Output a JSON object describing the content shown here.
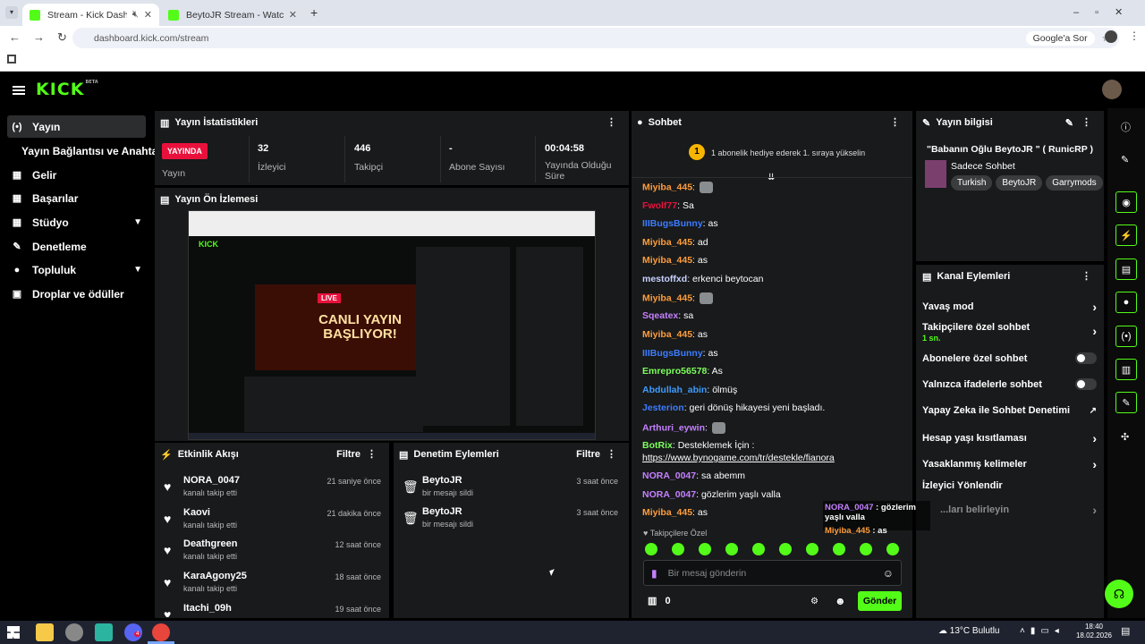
{
  "browser": {
    "tabs": [
      {
        "title": "Stream - Kick Dashboard"
      },
      {
        "title": "BeytoJR Stream - Watch Live on"
      }
    ],
    "url": "dashboard.kick.com/stream",
    "google_btn": "Google'a Sor"
  },
  "app": {
    "logo": "KICK",
    "beta": "BETA"
  },
  "sidebar": {
    "items": [
      {
        "label": "Yayın",
        "icon": "broadcast-icon"
      },
      {
        "label": "Yayın Bağlantısı ve Anahtarı"
      },
      {
        "label": "Gelir",
        "icon": "chart-icon"
      },
      {
        "label": "Başarılar",
        "icon": "trophy-icon"
      },
      {
        "label": "Stüdyo",
        "icon": "grid-icon"
      },
      {
        "label": "Denetleme",
        "icon": "wrench-icon"
      },
      {
        "label": "Topluluk",
        "icon": "people-icon"
      },
      {
        "label": "Droplar ve ödüller",
        "icon": "gift-icon"
      }
    ]
  },
  "stats": {
    "title": "Yayın İstatistikleri",
    "live_badge": "YAYINDA",
    "live_label": "Yayın",
    "viewers": "32",
    "viewers_label": "İzleyici",
    "followers": "446",
    "followers_label": "Takipçi",
    "subs": "-",
    "subs_label": "Abone Sayısı",
    "uptime": "00:04:58",
    "uptime_label": "Yayında Olduğu Süre"
  },
  "preview": {
    "title": "Yayın Ön İzlemesi",
    "thumb_text": "CANLI YAYIN BAŞLIYOR!",
    "thumb_live": "LIVE"
  },
  "activity": {
    "title": "Etkinlik Akışı",
    "filter": "Filtre",
    "items": [
      {
        "name": "NORA_0047",
        "sub": "kanalı takip etti",
        "time": "21 saniye önce"
      },
      {
        "name": "Kaovi",
        "sub": "kanalı takip etti",
        "time": "21 dakika önce"
      },
      {
        "name": "Deathgreen",
        "sub": "kanalı takip etti",
        "time": "12 saat önce"
      },
      {
        "name": "KaraAgony25",
        "sub": "kanalı takip etti",
        "time": "18 saat önce"
      },
      {
        "name": "Itachi_09h",
        "sub": "",
        "time": "19 saat önce"
      }
    ]
  },
  "moderation": {
    "title": "Denetim Eylemleri",
    "filter": "Filtre",
    "items": [
      {
        "name": "BeytoJR",
        "sub": "bir mesajı sildi",
        "time": "3 saat önce"
      },
      {
        "name": "BeytoJR",
        "sub": "bir mesajı sildi",
        "time": "3 saat önce"
      }
    ]
  },
  "chat": {
    "title": "Sohbet",
    "banner": "1 abonelik hediye ederek 1. sıraya yükselin",
    "banner_num": "1",
    "messages": [
      {
        "user": "Miyiba_445",
        "color": "#ff9d3c",
        "text": ""
      },
      {
        "user": "Fwolf77",
        "color": "#e9113c",
        "text": "Sa"
      },
      {
        "user": "IIIBugsBunny",
        "color": "#3d7cff",
        "text": "as"
      },
      {
        "user": "Miyiba_445",
        "color": "#ff9d3c",
        "text": "ad"
      },
      {
        "user": "Miyiba_445",
        "color": "#ff9d3c",
        "text": "as"
      },
      {
        "user": "mestoffxd",
        "color": "#c9d1ff",
        "text": "erkenci beytocan"
      },
      {
        "user": "Miyiba_445",
        "color": "#ff9d3c",
        "text": ""
      },
      {
        "user": "Sqeatex",
        "color": "#c580ff",
        "text": "sa"
      },
      {
        "user": "Miyiba_445",
        "color": "#ff9d3c",
        "text": "as"
      },
      {
        "user": "IIIBugsBunny",
        "color": "#3d7cff",
        "text": "as"
      },
      {
        "user": "Emrepro56578",
        "color": "#7dff5c",
        "text": "As"
      },
      {
        "user": "Abdullah_abin",
        "color": "#3d9cff",
        "text": "ölmüş"
      },
      {
        "user": "Jesterion",
        "color": "#3d7cff",
        "text": "geri dönüş hikayesi yeni başladı."
      },
      {
        "user": "Arthuri_eywin",
        "color": "#c580ff",
        "text": ""
      },
      {
        "user": "BotRix",
        "color": "#7dff5c",
        "text": "Desteklemek İçin :"
      },
      {
        "user": "",
        "color": "#fff",
        "text": "https://www.bynogame.com/tr/destekle/fianora"
      },
      {
        "user": "NORA_0047",
        "color": "#c580ff",
        "text": "sa abemm"
      },
      {
        "user": "NORA_0047",
        "color": "#c580ff",
        "text": "gözlerim yaşlı valla"
      },
      {
        "user": "Miyiba_445",
        "color": "#ff9d3c",
        "text": "as"
      }
    ],
    "followers_only": "Takipçilere Özel",
    "input_placeholder": "Bir mesaj gönderin",
    "points": "0",
    "send": "Gönder"
  },
  "overlay": {
    "lines": [
      {
        "user": "NORA_0047",
        "text": "gözlerim yaşlı valla"
      },
      {
        "user": "Miyiba_445",
        "text": "as"
      }
    ]
  },
  "info": {
    "title": "Yayın bilgisi",
    "stream_title": "\"Babanın Oğlu BeytoJR \" ( RunicRP )",
    "category": "Sadece Sohbet",
    "tags": [
      "Turkish",
      "BeytoJR",
      "Garrymods"
    ]
  },
  "channel_actions": {
    "title": "Kanal Eylemleri",
    "items": [
      {
        "label": "Yavaş mod",
        "kind": "arrow"
      },
      {
        "label": "Takipçilere özel sohbet",
        "sub": "1 sn.",
        "kind": "arrow"
      },
      {
        "label": "Abonelere özel sohbet",
        "kind": "toggle"
      },
      {
        "label": "Yalnızca ifadelerle sohbet",
        "kind": "toggle"
      },
      {
        "label": "Yapay Zeka ile Sohbet Denetimi",
        "kind": "link"
      },
      {
        "label": "Hesap yaşı kısıtlaması",
        "kind": "arrow"
      },
      {
        "label": "Yasaklanmış kelimeler",
        "kind": "arrow"
      },
      {
        "label": "İzleyici Yönlendir",
        "kind": "none"
      },
      {
        "label": "...ları belirleyin",
        "kind": "arrow"
      }
    ]
  },
  "taskbar": {
    "weather": "13°C Bulutlu",
    "time": "18:40",
    "date": "18.02.2026",
    "badge": "4"
  },
  "colors": {
    "accent": "#53fc18",
    "live": "#e9113c",
    "panel": "#181a1b"
  }
}
